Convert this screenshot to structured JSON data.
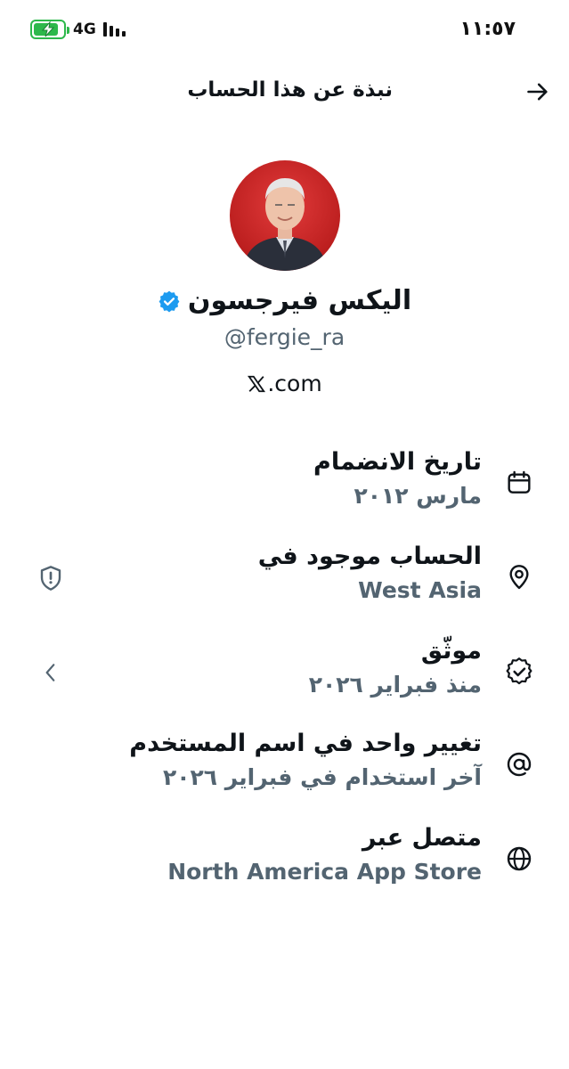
{
  "status_bar": {
    "time": "١١:٥٧",
    "network": "4G",
    "battery_level": 0.85
  },
  "header": {
    "title": "نبذة عن هذا الحساب"
  },
  "profile": {
    "display_name": "اليكس فيرجسون",
    "handle": "@fergie_ra",
    "website_suffix": ".com",
    "verified_color": "#1d9bf0"
  },
  "info": {
    "joined": {
      "title": "تاريخ الانضمام",
      "value": "مارس ٢٠١٢"
    },
    "location": {
      "title": "الحساب موجود في",
      "value": "West Asia"
    },
    "verified": {
      "title": "موثّق",
      "value": "منذ فبراير ٢٠٢٦"
    },
    "username_changes": {
      "title": "تغيير واحد في اسم المستخدم",
      "value": "آخر استخدام في فبراير ٢٠٢٦"
    },
    "connected_via": {
      "title": "متصل عبر",
      "value": "North America App Store"
    }
  },
  "icons": {
    "back": "arrow-right-icon",
    "joined": "calendar-icon",
    "location": "location-pin-icon",
    "verified": "verified-seal-icon",
    "username": "at-sign-icon",
    "connected": "globe-icon",
    "location_action": "shield-alert-icon",
    "verified_action": "chevron-left-icon"
  }
}
